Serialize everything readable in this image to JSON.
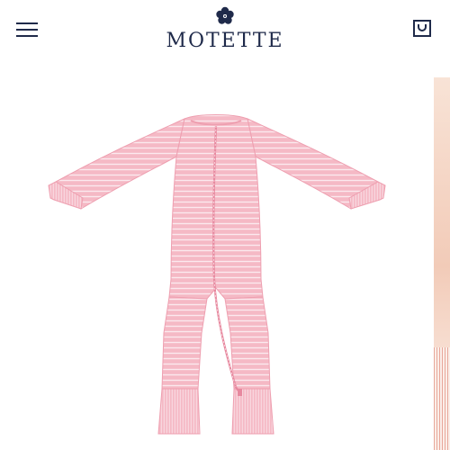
{
  "header": {
    "brand_name": "MOTETTE",
    "logo_icon": "flower-icon",
    "menu_icon": "hamburger-menu-icon",
    "cart_icon": "shopping-bag-icon"
  },
  "colors": {
    "brand": "#1f2a4a",
    "product_pink": "#f4b8c4",
    "stripe_white": "#fbe9ee"
  },
  "gallery": {
    "main_image": "pink-striped-zip-romper",
    "next_image": "peach-striped-garment-preview"
  }
}
